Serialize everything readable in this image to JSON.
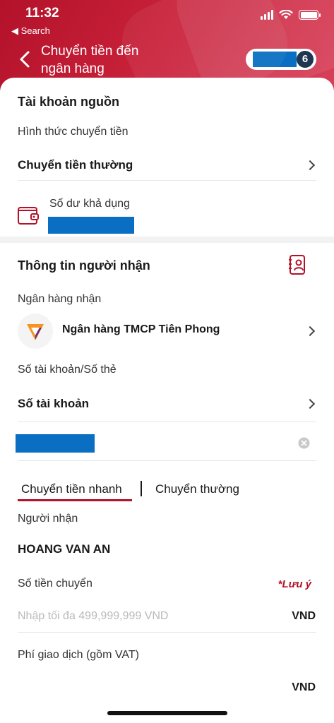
{
  "status_bar": {
    "time": "11:32",
    "back_label": "◀ Search"
  },
  "header": {
    "title": "Chuyển tiền đến ngân hàng",
    "notification_count": "6",
    "accent": "#b3122a"
  },
  "source_section": {
    "heading": "Tài khoản nguồn",
    "transfer_method_label": "Hình thức chuyển tiền",
    "transfer_method_value": "Chuyển tiền thường",
    "balance_label": "Số dư khả dụng"
  },
  "recipient_section": {
    "heading": "Thông tin người nhận",
    "bank_label": "Ngân hàng nhận",
    "bank_name": "Ngân hàng TMCP Tiên Phong",
    "account_type_label": "Số tài khoản/Số thẻ",
    "account_type_value": "Số tài khoản"
  },
  "tabs": [
    {
      "label": "Chuyển tiền nhanh",
      "active": true
    },
    {
      "label": "Chuyển thường",
      "active": false
    }
  ],
  "recipient": {
    "label": "Người nhận",
    "name": "HOANG VAN AN"
  },
  "amount": {
    "label": "Số tiền chuyển",
    "note": "*Lưu ý",
    "placeholder": "Nhập tối đa 499,999,999 VND",
    "currency": "VND"
  },
  "fee": {
    "label": "Phí giao dịch (gồm VAT)",
    "currency": "VND"
  }
}
